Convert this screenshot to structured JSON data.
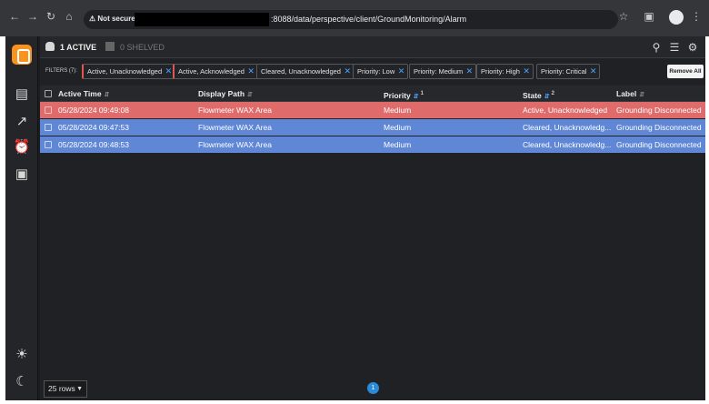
{
  "browser": {
    "secure_label": "Not secure",
    "url": ":8088/data/perspective/client/GroundMonitoring/Alarm"
  },
  "tabs": {
    "active_label": "1 ACTIVE",
    "shelved_label": "0 SHELVED"
  },
  "filters": {
    "label": "FILTERS (7):",
    "chips": [
      "Active, Unacknowledged",
      "Active, Acknowledged",
      "Cleared, Unacknowledged",
      "Priority: Low",
      "Priority: Medium",
      "Priority: High",
      "Priority: Critical"
    ],
    "remove_all": "Remove All"
  },
  "table": {
    "columns": {
      "active_time": "Active Time",
      "display_path": "Display Path",
      "priority": "Priority",
      "priority_sort_order": "1",
      "state": "State",
      "state_sort_order": "2",
      "label": "Label"
    },
    "rows": [
      {
        "active_time": "05/28/2024 09:49:08",
        "display_path": "Flowmeter WAX Area",
        "priority": "Medium",
        "state": "Active, Unacknowledged",
        "label": "Grounding Disconnected",
        "status": "active"
      },
      {
        "active_time": "05/28/2024 09:47:53",
        "display_path": "Flowmeter WAX Area",
        "priority": "Medium",
        "state": "Cleared, Unacknowledg...",
        "label": "Grounding Disconnected",
        "status": "cleared"
      },
      {
        "active_time": "05/28/2024 09:48:53",
        "display_path": "Flowmeter WAX Area",
        "priority": "Medium",
        "state": "Cleared, Unacknowledg...",
        "label": "Grounding Disconnected",
        "status": "cleared"
      }
    ]
  },
  "footer": {
    "rows_per_page": "25 rows",
    "current_page": "1"
  },
  "colors": {
    "active_row": "#e06b6b",
    "cleared_row": "#5f87d6",
    "accent": "#2b8ad8",
    "logo": "#f7931e"
  }
}
